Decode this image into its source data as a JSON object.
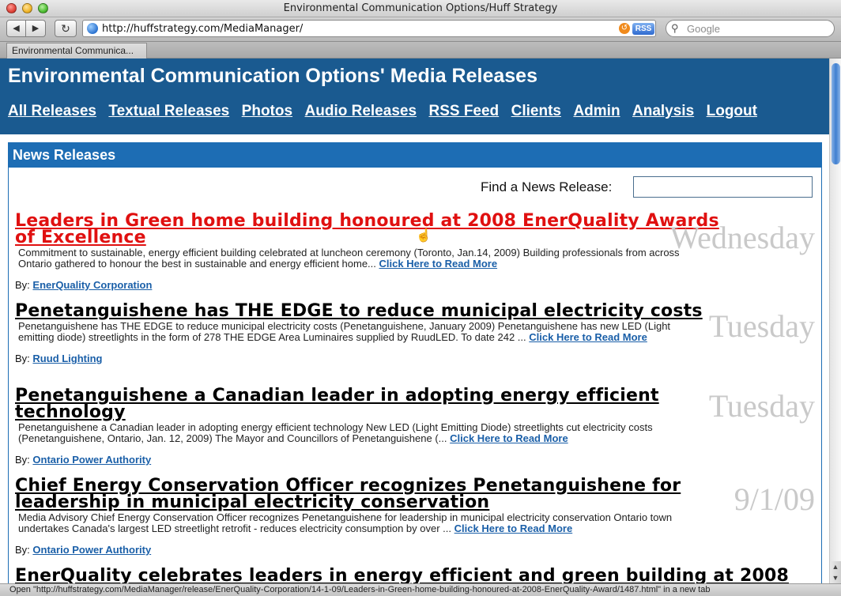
{
  "window": {
    "title": "Environmental Communication Options/Huff Strategy"
  },
  "toolbar": {
    "back_icon": "◀",
    "forward_icon": "▶",
    "reload_icon": "↻",
    "url": "http://huffstrategy.com/MediaManager/",
    "rss_label": "RSS",
    "search_placeholder": "Google"
  },
  "tabs": [
    {
      "label": "Environmental Communica..."
    }
  ],
  "site": {
    "title": "Environmental Communication Options' Media Releases",
    "nav": [
      {
        "label": "All Releases"
      },
      {
        "label": "Textual Releases"
      },
      {
        "label": "Photos"
      },
      {
        "label": "Audio Releases"
      },
      {
        "label": "RSS Feed"
      },
      {
        "label": "Clients"
      },
      {
        "label": "Admin"
      },
      {
        "label": "Analysis"
      },
      {
        "label": "Logout"
      }
    ]
  },
  "panel": {
    "heading": "News Releases",
    "find_label": "Find a News Release:",
    "find_value": ""
  },
  "releases": [
    {
      "title": "Leaders in Green home building honoured at 2008 EnerQuality Awards of Excellence",
      "summary": "Commitment to sustainable, energy efficient building celebrated at luncheon ceremony (Toronto, Jan.14, 2009) Building professionals from across Ontario gathered to honour the best in sustainable and energy efficient home...",
      "read_more": "Click Here to Read More",
      "by_label": "By:",
      "client": "EnerQuality Corporation",
      "date": "Wednesday"
    },
    {
      "title": "Penetanguishene has THE EDGE to reduce municipal electricity costs",
      "summary": "Penetanguishene has THE EDGE to reduce municipal electricity costs (Penetanguishene, January 2009) Penetanguishene has new LED (Light emitting diode) streetlights in the form of 278 THE EDGE Area Luminaires supplied by RuudLED. To date 242 ...",
      "read_more": "Click Here to Read More",
      "by_label": "By:",
      "client": "Ruud Lighting",
      "date": "Tuesday"
    },
    {
      "title": "Penetanguishene a Canadian leader in adopting energy efficient technology",
      "summary": "Penetanguishene a Canadian leader in adopting energy efficient technology New LED (Light Emitting Diode) streetlights cut electricity costs (Penetanguishene, Ontario, Jan. 12, 2009) The Mayor and Councillors of Penetanguishene (...",
      "read_more": "Click Here to Read More",
      "by_label": "By:",
      "client": "Ontario Power Authority",
      "date": "Tuesday"
    },
    {
      "title": "Chief Energy Conservation Officer recognizes Penetanguishene for leadership in municipal electricity conservation",
      "summary": "Media Advisory Chief Energy Conservation Officer recognizes Penetanguishene for leadership in municipal electricity conservation Ontario town undertakes Canada's largest LED streetlight retrofit - reduces electricity consumption by over ...",
      "read_more": "Click Here to Read More",
      "by_label": "By:",
      "client": "Ontario Power Authority",
      "date": "9/1/09"
    },
    {
      "title": "EnerQuality celebrates leaders in energy efficient and green building at 2008",
      "summary": "",
      "read_more": "",
      "by_label": "",
      "client": "",
      "date": ""
    }
  ],
  "status_bar": {
    "text": "Open \"http://huffstrategy.com/MediaManager/release/EnerQuality-Corporation/14-1-09/Leaders-in-Green-home-building-honoured-at-2008-EnerQuality-Award/1487.html\" in a new tab"
  },
  "colors": {
    "header_bg": "#1a5a90",
    "panel_accent": "#1d6db4",
    "hover_link": "#e01010",
    "link": "#1a5fa8",
    "date_watermark": "#c9c9c9"
  }
}
